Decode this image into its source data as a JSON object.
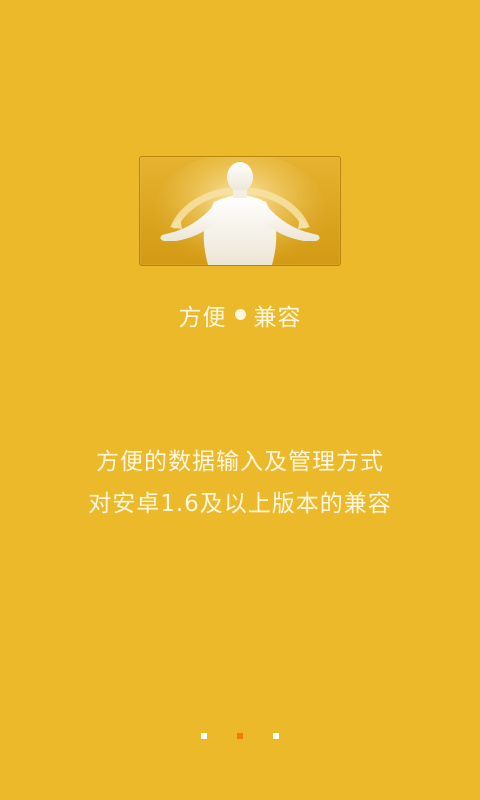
{
  "hero": {
    "image": "person-open-arms-illustration"
  },
  "subtitle": {
    "left": "方便",
    "right": "兼容"
  },
  "description": {
    "line1": "方便的数据输入及管理方式",
    "line2": "对安卓1.6及以上版本的兼容"
  },
  "pager": {
    "count": 3,
    "active_index": 1
  },
  "colors": {
    "background": "#ECB92B",
    "active_dot": "#F07A0C",
    "inactive_dot": "#FFFFFF",
    "text": "#FFF7E0"
  }
}
